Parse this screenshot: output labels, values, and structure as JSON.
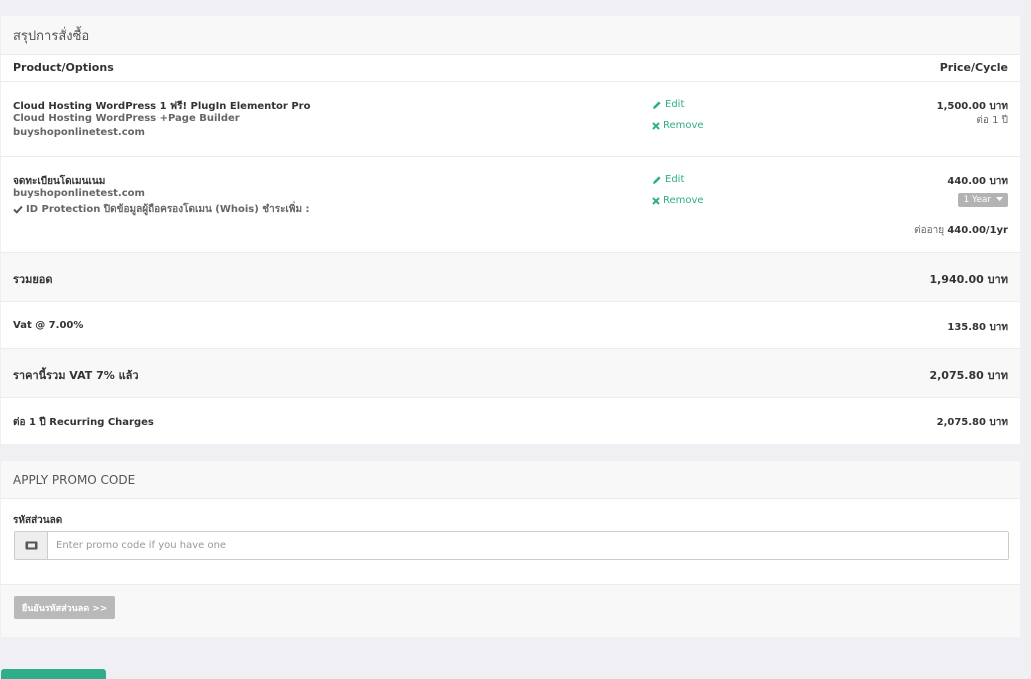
{
  "summary": {
    "title": "สรุปการสั่งซื้อ",
    "col_product": "Product/Options",
    "col_price": "Price/Cycle",
    "items": [
      {
        "name": "Cloud Hosting WordPress 1 ฟรี! PlugIn Elementor Pro",
        "line2": "Cloud Hosting WordPress +Page Builder",
        "line3": "buyshoponlinetest.com",
        "edit": "Edit",
        "remove": "Remove",
        "price": "1,500.00 บาท",
        "cycle": "ต่อ 1 ปี"
      },
      {
        "name": "จดทะเบียนโดเมนเนม",
        "line2": "buyshoponlinetest.com",
        "line3": "ID Protection ปิดข้อมูลผู้ถือครองโดเมน (Whois) ชำระเพิ่ม :",
        "edit": "Edit",
        "remove": "Remove",
        "price": "440.00 บาท",
        "period": "1 Year",
        "renewal_label": "ต่ออายุ",
        "renewal_value": "440.00/1yr"
      }
    ],
    "subtotal_label": "รวมยอด",
    "subtotal_value": "1,940.00 บาท",
    "vat_label": "Vat @ 7.00%",
    "vat_value": "135.80 บาท",
    "total_label": "ราคานี้รวม VAT 7% แล้ว",
    "total_value": "2,075.80 บาท",
    "recurring_label": "ต่อ 1 ปี Recurring Charges",
    "recurring_value": "2,075.80 บาท"
  },
  "promo": {
    "title": "APPLY PROMO CODE",
    "field_label": "รหัสส่วนลด",
    "placeholder": "Enter promo code if you have one",
    "button": "ยืนยันรหัสส่วนลด >>"
  },
  "colors": {
    "accent": "#2eae8a",
    "background": "#efeff4"
  },
  "icons": {
    "edit": "pencil-icon",
    "remove": "times-icon",
    "check": "check-icon",
    "ticket": "ticket-icon",
    "caret": "caret-down-icon"
  }
}
